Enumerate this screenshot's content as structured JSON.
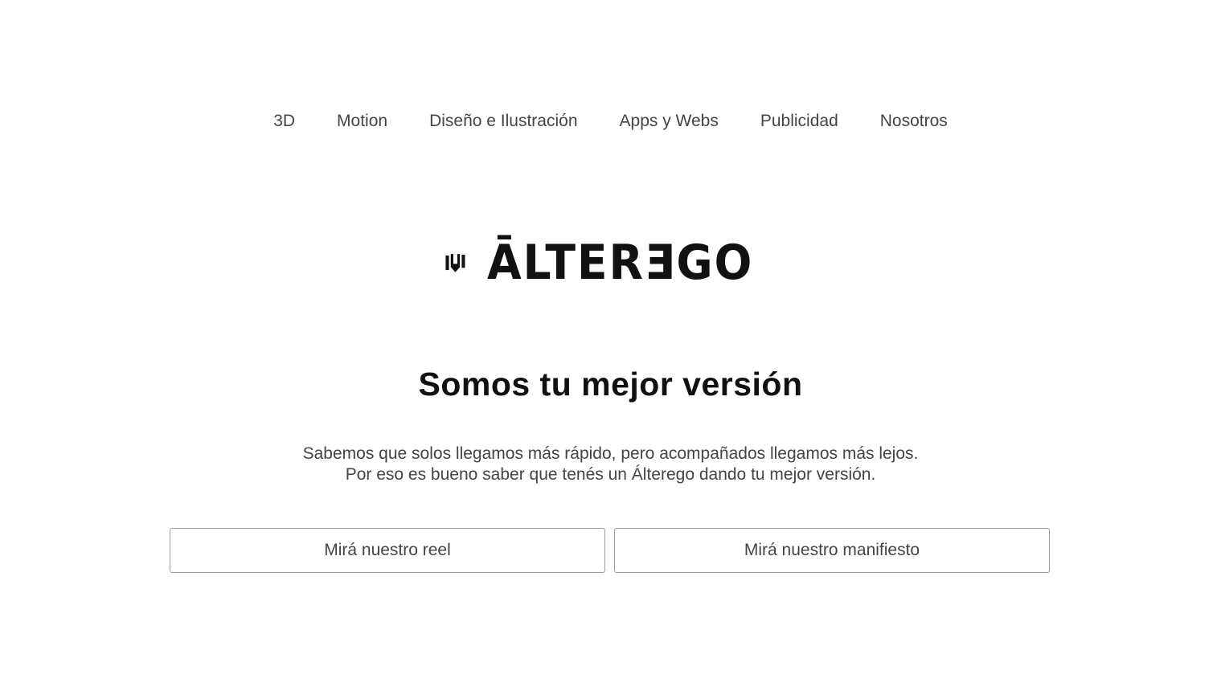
{
  "nav": {
    "items": [
      {
        "label": "3D"
      },
      {
        "label": "Motion"
      },
      {
        "label": "Diseño e Ilustración"
      },
      {
        "label": "Apps y Webs"
      },
      {
        "label": "Publicidad"
      },
      {
        "label": "Nosotros"
      }
    ]
  },
  "logo": {
    "wordmark": "ĀLTERƎGO",
    "icon": "alterego-pen-mark-icon"
  },
  "hero": {
    "title": "Somos tu mejor versión",
    "subtitle_line1": "Sabemos que solos llegamos más rápido, pero acompañados llegamos más lejos.",
    "subtitle_line2": "Por eso es bueno saber que tenés un Álterego dando tu mejor versión."
  },
  "actions": {
    "reel_label": "Mirá nuestro reel",
    "manifest_label": "Mirá nuestro manifiesto"
  },
  "colors": {
    "background": "#ffffff",
    "text": "#444444",
    "heading": "#111111",
    "button_border": "#9a9a9a"
  }
}
